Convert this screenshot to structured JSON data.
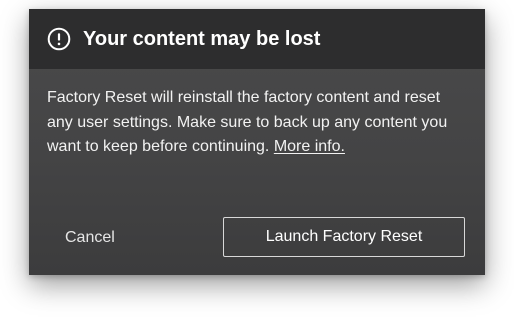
{
  "dialog": {
    "icon": "exclamation-circle-icon",
    "title": "Your content may be lost",
    "message": "Factory Reset will reinstall the factory content and reset any user settings. Make sure to back up any content you want to keep before continuing. ",
    "link_text": "More info.",
    "cancel_label": "Cancel",
    "confirm_label": "Launch Factory Reset"
  },
  "colors": {
    "header_background": "#2d2d2e",
    "dialog_background": "#464647",
    "text": "#ffffff",
    "button_border": "#d8d8d8"
  }
}
